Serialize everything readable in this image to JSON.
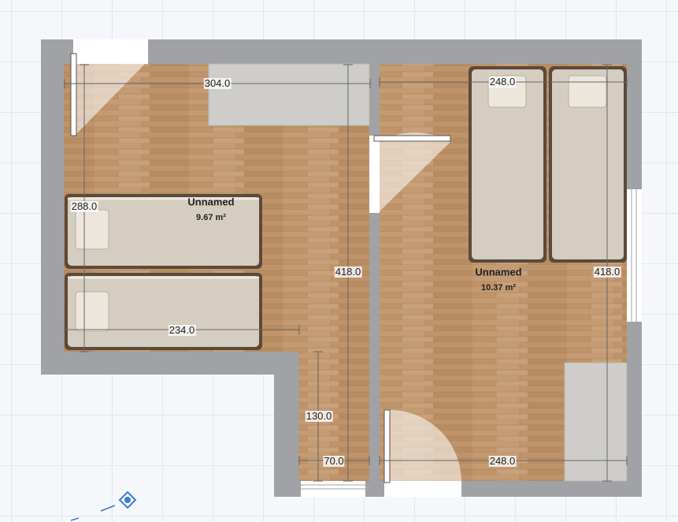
{
  "rooms": [
    {
      "name": "Unnamed",
      "area": "9.67 m²"
    },
    {
      "name": "Unnamed",
      "area": "10.37 m²"
    }
  ],
  "dimensions": {
    "left_top_width": "304.0",
    "left_height": "288.0",
    "left_bottom_width": "234.0",
    "center_height": "418.0",
    "corridor_height": "130.0",
    "corridor_width": "70.0",
    "right_top_width": "248.0",
    "right_height": "418.0",
    "right_bottom_width": "248.0"
  },
  "colors": {
    "wall": "#9fa1a5",
    "floor": "#bc936a",
    "furniture": "#cfcdc8",
    "bed": "#d7cec2"
  },
  "icons": {
    "compass": "compass-icon"
  }
}
